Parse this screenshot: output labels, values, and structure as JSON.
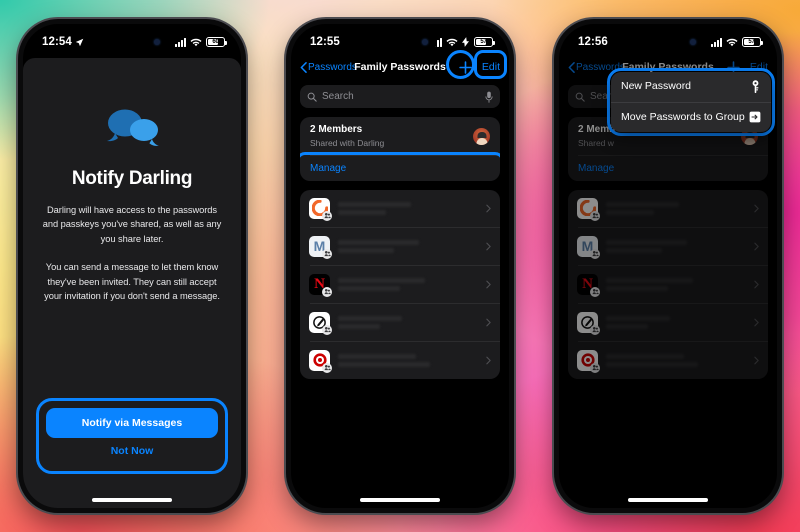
{
  "background": {
    "gradient_colors": [
      "#2dc9aa",
      "#f6ab3f",
      "#ec2496",
      "#f2394f"
    ]
  },
  "accent_color": "#0a84ff",
  "phones": [
    {
      "id": "phone-notify",
      "status_bar": {
        "time": "12:54",
        "location_icon": "location-arrow-icon",
        "cellular_icon": "cellular-bars-icon",
        "wifi_icon": "wifi-icon",
        "battery_level": "60",
        "battery_charging": false
      },
      "screen": {
        "icon": "chat-bubbles-icon",
        "title": "Notify Darling",
        "paragraphs": [
          "Darling will have access to the passwords and passkeys you've shared, as well as any you share later.",
          "You can send a message to let them know they've been invited. They can still accept your invitation if you don't send a message."
        ],
        "primary_button": "Notify via Messages",
        "secondary_button": "Not Now"
      }
    },
    {
      "id": "phone-group-list",
      "status_bar": {
        "time": "12:55",
        "cellular_icon": "cellular-bars-icon",
        "wifi_icon": "wifi-icon",
        "battery_level": "57",
        "battery_charging": true
      },
      "nav": {
        "back_label": "Passwords",
        "title": "Family Passwords",
        "add_icon": "plus-icon",
        "edit_label": "Edit"
      },
      "search": {
        "placeholder": "Search",
        "icon": "search-icon",
        "dictate_icon": "microphone-icon"
      },
      "members": {
        "title": "2 Members",
        "subtitle": "Shared with Darling",
        "avatar": "member-avatar",
        "manage_label": "Manage"
      },
      "entries": [
        {
          "icon": "ring-orange-icon",
          "glyph": "",
          "shared": true
        },
        {
          "icon": "mail-m-icon",
          "glyph": "M",
          "shared": true
        },
        {
          "icon": "netflix-n-icon",
          "glyph": "N",
          "shared": true
        },
        {
          "icon": "pen-circle-icon",
          "glyph": "",
          "shared": true
        },
        {
          "icon": "target-red-icon",
          "glyph": "",
          "shared": true
        }
      ],
      "highlights": [
        "add-button",
        "edit-button",
        "manage-row"
      ]
    },
    {
      "id": "phone-context-menu",
      "status_bar": {
        "time": "12:56",
        "cellular_icon": "cellular-bars-icon",
        "wifi_icon": "wifi-icon",
        "battery_level": "57",
        "battery_charging": false
      },
      "nav": {
        "back_label": "Passwords",
        "title": "Family Passwords",
        "add_icon": "plus-icon",
        "edit_label": "Edit"
      },
      "search": {
        "placeholder": "Search",
        "icon": "search-icon",
        "dictate_icon": "microphone-icon"
      },
      "members": {
        "title": "2 Memb",
        "subtitle": "Shared w",
        "manage_label": "Manage"
      },
      "context_menu": {
        "items": [
          {
            "label": "New Password",
            "icon": "key-icon"
          },
          {
            "label": "Move Passwords to Group",
            "icon": "move-to-folder-icon"
          }
        ]
      },
      "entries": [
        {
          "icon": "ring-orange-icon",
          "glyph": "",
          "shared": true
        },
        {
          "icon": "mail-m-icon",
          "glyph": "M",
          "shared": true
        },
        {
          "icon": "netflix-n-icon",
          "glyph": "N",
          "shared": true
        },
        {
          "icon": "pen-circle-icon",
          "glyph": "",
          "shared": true
        },
        {
          "icon": "target-red-icon",
          "glyph": "",
          "shared": true
        }
      ],
      "highlights": [
        "context-menu"
      ]
    }
  ]
}
